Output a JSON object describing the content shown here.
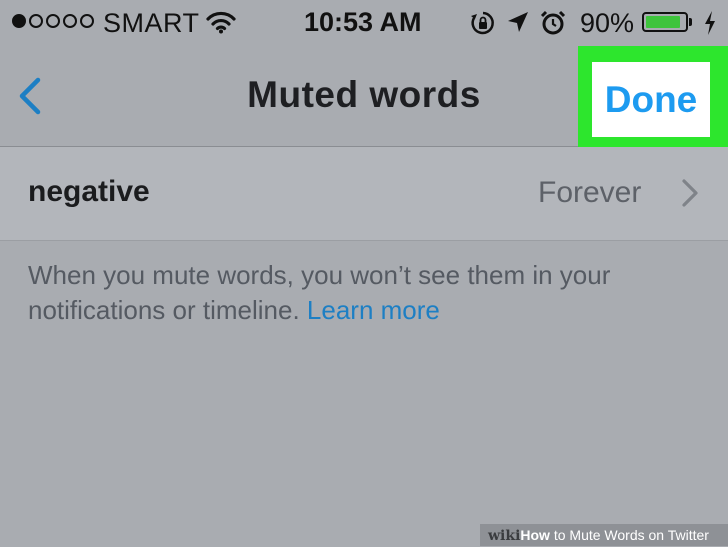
{
  "status_bar": {
    "signal_dots_filled": 1,
    "signal_dots_total": 5,
    "carrier": "SMART",
    "time": "10:53 AM",
    "battery_percent": "90%",
    "battery_level": 0.9,
    "icons": [
      "wifi-icon",
      "orientation-lock-icon",
      "location-arrow-icon",
      "alarm-clock-icon",
      "charging-bolt-icon"
    ]
  },
  "nav": {
    "back_icon": "chevron-left-icon",
    "title": "Muted words",
    "done_label": "Done"
  },
  "muted_words": [
    {
      "word": "negative",
      "duration": "Forever"
    }
  ],
  "info": {
    "text": "When you mute words, you won’t see them in your notifications or timeline.",
    "link": "Learn more"
  },
  "watermark": {
    "logo_wiki": "wiki",
    "logo_how": "How",
    "caption": " to Mute Words on Twitter"
  },
  "colors": {
    "background": "#a9acb1",
    "accent": "#1d9bf0",
    "highlight": "#2de62d",
    "battery": "#3ec43c"
  }
}
